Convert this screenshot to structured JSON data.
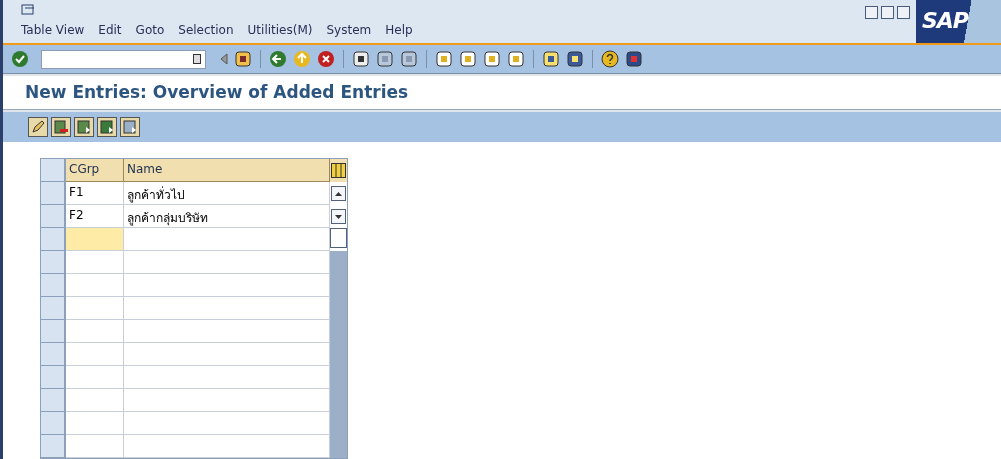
{
  "menu": [
    "Table View",
    "Edit",
    "Goto",
    "Selection",
    "Utilities(M)",
    "System",
    "Help"
  ],
  "logo": "SAP",
  "screen_title": "New Entries: Overview of Added Entries",
  "table": {
    "columns": [
      "CGrp",
      "Name"
    ],
    "rows": [
      {
        "cgrp": "F1",
        "name": "ลูกค้าทั่วไป"
      },
      {
        "cgrp": "F2",
        "name": "ลูกค้ากลุ่มบริษัท"
      }
    ]
  }
}
